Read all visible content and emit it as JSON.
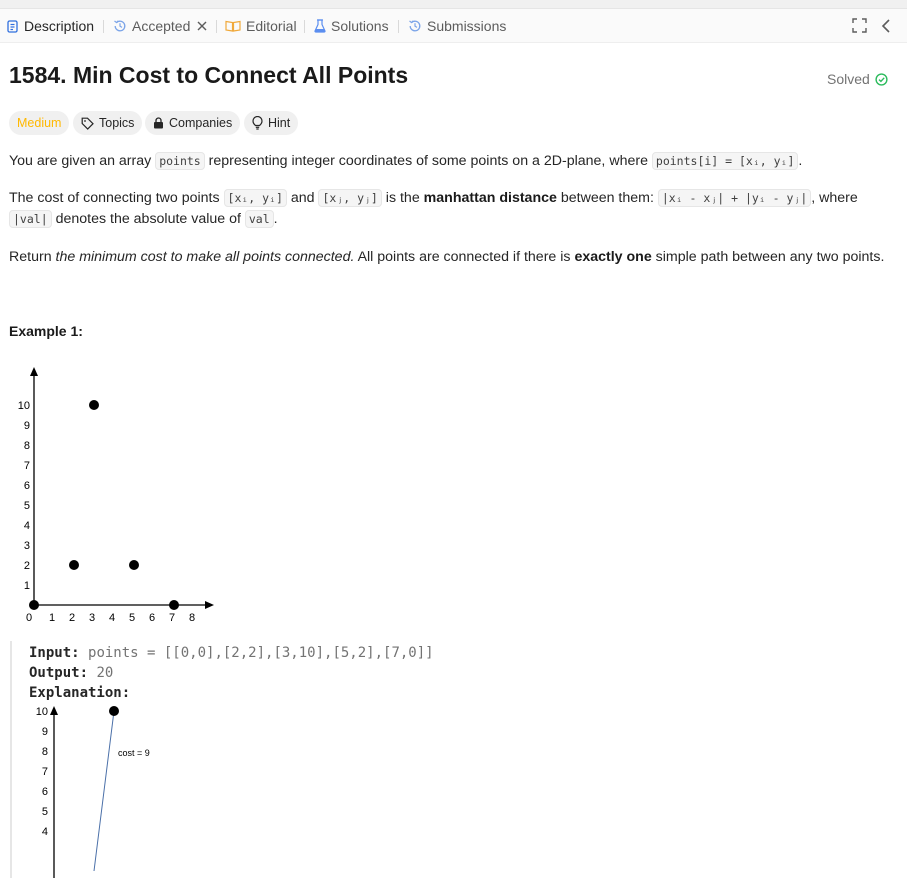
{
  "tabs": {
    "description": "Description",
    "accepted": "Accepted",
    "editorial": "Editorial",
    "solutions": "Solutions",
    "submissions": "Submissions"
  },
  "problem": {
    "title": "1584. Min Cost to Connect All Points",
    "status": "Solved",
    "difficulty": "Medium",
    "tags": {
      "topics": "Topics",
      "companies": "Companies",
      "hint": "Hint"
    }
  },
  "description": {
    "p1_a": "You are given an array ",
    "p1_code1": "points",
    "p1_b": " representing integer coordinates of some points on a 2D-plane, where ",
    "p1_code2": "points[i] = [xᵢ, yᵢ]",
    "p1_c": ".",
    "p2_a": "The cost of connecting two points ",
    "p2_code1": "[xᵢ, yᵢ]",
    "p2_b": " and ",
    "p2_code2": "[xⱼ, yⱼ]",
    "p2_c": " is the ",
    "p2_bold": "manhattan distance",
    "p2_d": " between them: ",
    "p2_code3": "|xᵢ - xⱼ| + |yᵢ - yⱼ|",
    "p2_e": ", where ",
    "p2_code4": "|val|",
    "p2_f": " denotes the absolute value of ",
    "p2_code5": "val",
    "p2_g": ".",
    "p3_a": "Return ",
    "p3_italic": "the minimum cost to make all points connected.",
    "p3_b": " All points are connected if there is ",
    "p3_bold": "exactly one",
    "p3_c": " simple path between any two points."
  },
  "example1": {
    "heading": "Example 1:",
    "input_label": "Input:",
    "input_value": "points = [[0,0],[2,2],[3,10],[5,2],[7,0]]",
    "output_label": "Output:",
    "output_value": "20",
    "explanation_label": "Explanation:",
    "cost_label": "cost = 9"
  },
  "chart_data": [
    {
      "type": "scatter",
      "title": "",
      "xlabel": "",
      "ylabel": "",
      "x_ticks": [
        "0",
        "1",
        "2",
        "3",
        "4",
        "5",
        "6",
        "7",
        "8"
      ],
      "y_ticks": [
        "1",
        "2",
        "3",
        "4",
        "5",
        "6",
        "7",
        "8",
        "9",
        "10"
      ],
      "xlim": [
        0,
        9
      ],
      "ylim": [
        0,
        10.5
      ],
      "points": [
        [
          0,
          0
        ],
        [
          2,
          2
        ],
        [
          3,
          10
        ],
        [
          5,
          2
        ],
        [
          7,
          0
        ]
      ]
    },
    {
      "type": "scatter",
      "title": "",
      "xlabel": "",
      "ylabel": "",
      "y_ticks": [
        "4",
        "5",
        "6",
        "7",
        "8",
        "9",
        "10"
      ],
      "points": [
        [
          3,
          10
        ]
      ],
      "edges": [
        {
          "from": [
            2,
            2
          ],
          "to": [
            3,
            10
          ],
          "label": "cost = 9"
        }
      ]
    }
  ]
}
